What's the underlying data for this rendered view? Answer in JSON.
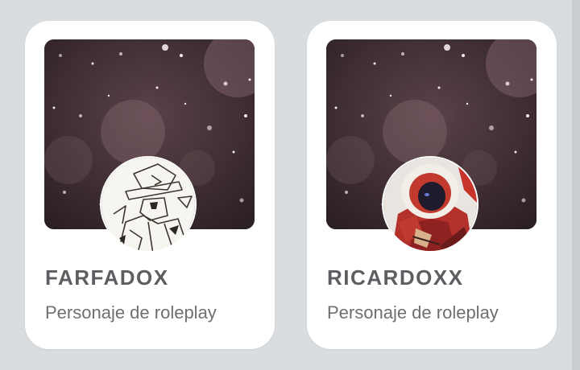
{
  "colors": {
    "background": "#d9dde0",
    "card": "#ffffff",
    "name_text": "#5c5e62",
    "subtitle_text": "#6d6f72"
  },
  "cards": [
    {
      "name": "FARFADOX",
      "subtitle": "Personaje de roleplay",
      "avatar_icon": "sketch-character-avatar"
    },
    {
      "name": "RICARDOXX",
      "subtitle": "Personaje de roleplay",
      "avatar_icon": "red-hooded-character-avatar"
    }
  ]
}
